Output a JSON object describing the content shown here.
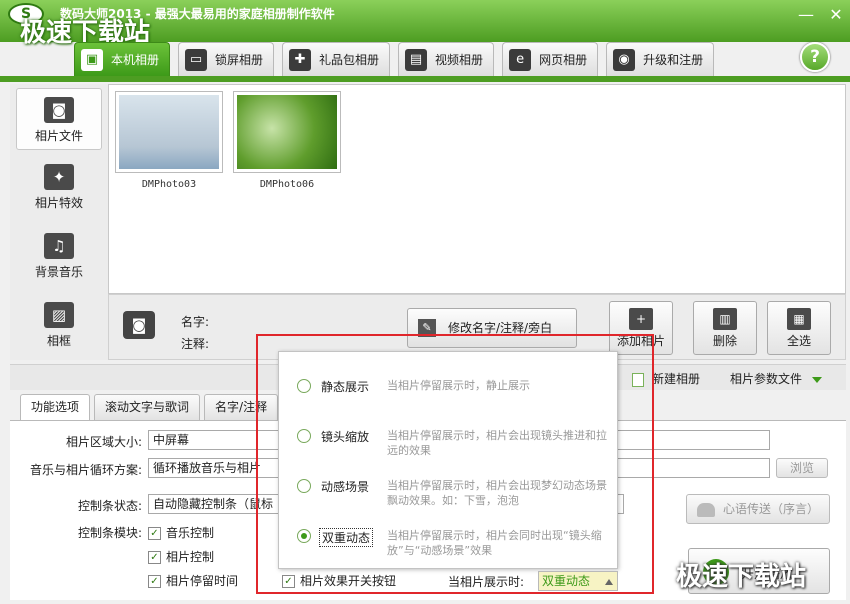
{
  "window": {
    "logo": "S",
    "title": "数码大师2013 - 最强大最易用的家庭相册制作软件",
    "minimize": "—",
    "close": "✕",
    "help": "?"
  },
  "watermark": "极速下载站",
  "tabs": [
    {
      "label": "本机相册",
      "icon": "person-photo-icon",
      "glyph": "▣"
    },
    {
      "label": "锁屏相册",
      "icon": "monitor-icon",
      "glyph": "▭"
    },
    {
      "label": "礼品包相册",
      "icon": "gift-icon",
      "glyph": "✚"
    },
    {
      "label": "视频相册",
      "icon": "film-icon",
      "glyph": "▤"
    },
    {
      "label": "网页相册",
      "icon": "ie-icon",
      "glyph": "e"
    },
    {
      "label": "升级和注册",
      "icon": "globe-icon",
      "glyph": "◉"
    }
  ],
  "sidebar": {
    "items": [
      {
        "label": "相片文件",
        "icon": "camera-icon",
        "glyph": "◙"
      },
      {
        "label": "相片特效",
        "icon": "effects-icon",
        "glyph": "✦"
      },
      {
        "label": "背景音乐",
        "icon": "music-note-icon",
        "glyph": "♫"
      },
      {
        "label": "相框",
        "icon": "frame-icon",
        "glyph": "▨"
      }
    ]
  },
  "photos": [
    {
      "caption": "DMPhoto03"
    },
    {
      "caption": "DMPhoto06"
    }
  ],
  "info": {
    "name_label": "名字:",
    "note_label": "注释:",
    "rename_button": "修改名字/注释/旁白",
    "add_photo": "添加相片",
    "delete": "删除",
    "select_all": "全选"
  },
  "toolbar2": {
    "new_album": "新建相册",
    "params": "相片参数文件"
  },
  "lower_tabs": [
    "功能选项",
    "滚动文字与歌词",
    "名字/注释"
  ],
  "form": {
    "area_size_label": "相片区域大小:",
    "area_size_value": "中屏幕",
    "loop_label": "音乐与相片循环方案:",
    "loop_value": "循环播放音乐与相片",
    "browse": "浏览",
    "ctrl_state_label": "控制条状态:",
    "ctrl_state_value": "自动隐藏控制条（鼠标",
    "ctrl_module_label": "控制条模块:",
    "checks": [
      "音乐控制",
      "相片控制",
      "相片停留时间",
      "相片效果开关按钮"
    ],
    "heart_button": "心语传送（序言）",
    "start_button": "开始播放"
  },
  "popup": {
    "options": [
      {
        "name": "静态展示",
        "desc": "当相片停留展示时，静止展示",
        "selected": false
      },
      {
        "name": "镜头缩放",
        "desc": "当相片停留展示时，相片会出现镜头推进和拉远的效果",
        "selected": false
      },
      {
        "name": "动感场景",
        "desc": "当相片停留展示时，相片会出现梦幻动态场景飘动效果。如：下雪，泡泡",
        "selected": false
      },
      {
        "name": "双重动态",
        "desc": "当相片停留展示时，相片会同时出现“镜头缩放”与“动感场景”效果",
        "selected": true
      }
    ],
    "status_label": "当相片展示时:",
    "status_value": "双重动态"
  },
  "colors": {
    "accent": "#3d9a19",
    "highlight": "#e0262b"
  }
}
